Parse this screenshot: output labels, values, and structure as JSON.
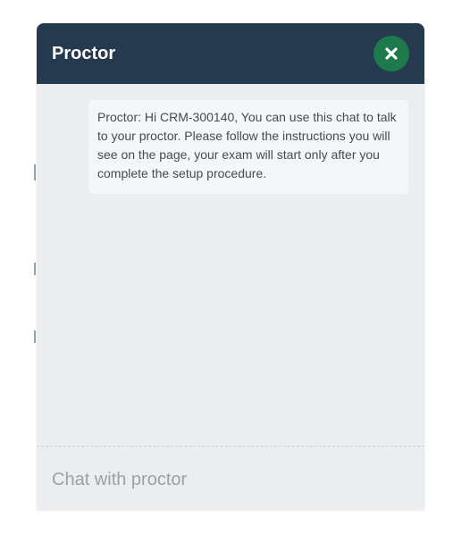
{
  "header": {
    "title": "Proctor",
    "close_icon": "close-icon"
  },
  "messages": [
    {
      "text": "Proctor: Hi CRM-300140, You can use this chat to talk to your proctor. Please follow the instructions you will see on the page, your exam will start only after you complete the setup procedure."
    }
  ],
  "input": {
    "placeholder": "Chat with proctor",
    "value": ""
  },
  "colors": {
    "header_bg": "#263a4f",
    "panel_bg": "#eaeef1",
    "close_button_bg": "#1e7a4a",
    "bubble_bg": "#f4f7f9"
  }
}
